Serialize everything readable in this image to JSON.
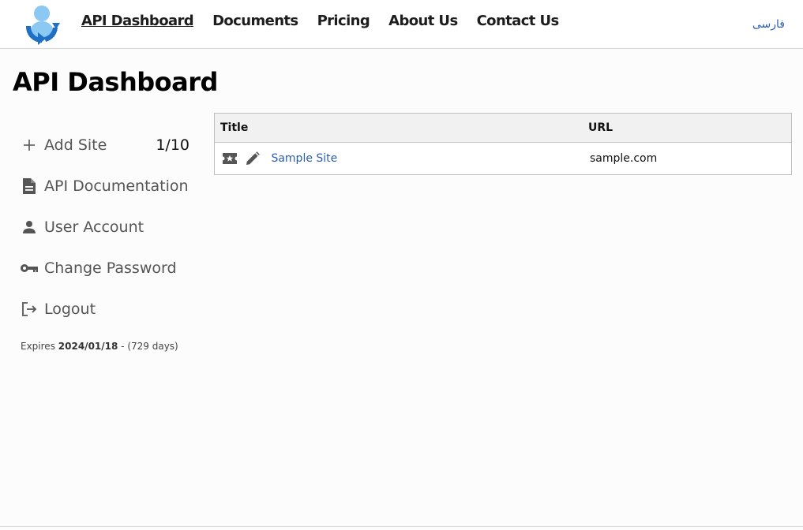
{
  "header": {
    "nav": [
      {
        "label": "API Dashboard"
      },
      {
        "label": "Documents"
      },
      {
        "label": "Pricing"
      },
      {
        "label": "About Us"
      },
      {
        "label": "Contact Us"
      }
    ],
    "language_link": "فارسی",
    "logo_icon": "logo-person-refresh-icon"
  },
  "page": {
    "title": "API Dashboard"
  },
  "sidebar": {
    "items": [
      {
        "label": "Add Site",
        "icon": "plus-icon",
        "count": "1/10"
      },
      {
        "label": "API Documentation",
        "icon": "document-icon"
      },
      {
        "label": "User Account",
        "icon": "person-icon"
      },
      {
        "label": "Change Password",
        "icon": "key-icon"
      },
      {
        "label": "Logout",
        "icon": "logout-icon"
      }
    ],
    "expires": {
      "prefix": "Expires",
      "date": "2024/01/18",
      "suffix": "- (729 days)"
    }
  },
  "table": {
    "headers": {
      "title": "Title",
      "url": "URL"
    },
    "rows": [
      {
        "title": "Sample Site",
        "url": "sample.com",
        "actions": [
          "ticket-star-icon",
          "pencil-icon"
        ]
      }
    ]
  },
  "colors": {
    "link": "#2b5fb1",
    "text": "#555555",
    "header_bg": "#f1f1f1",
    "border": "#bfbfbf"
  }
}
